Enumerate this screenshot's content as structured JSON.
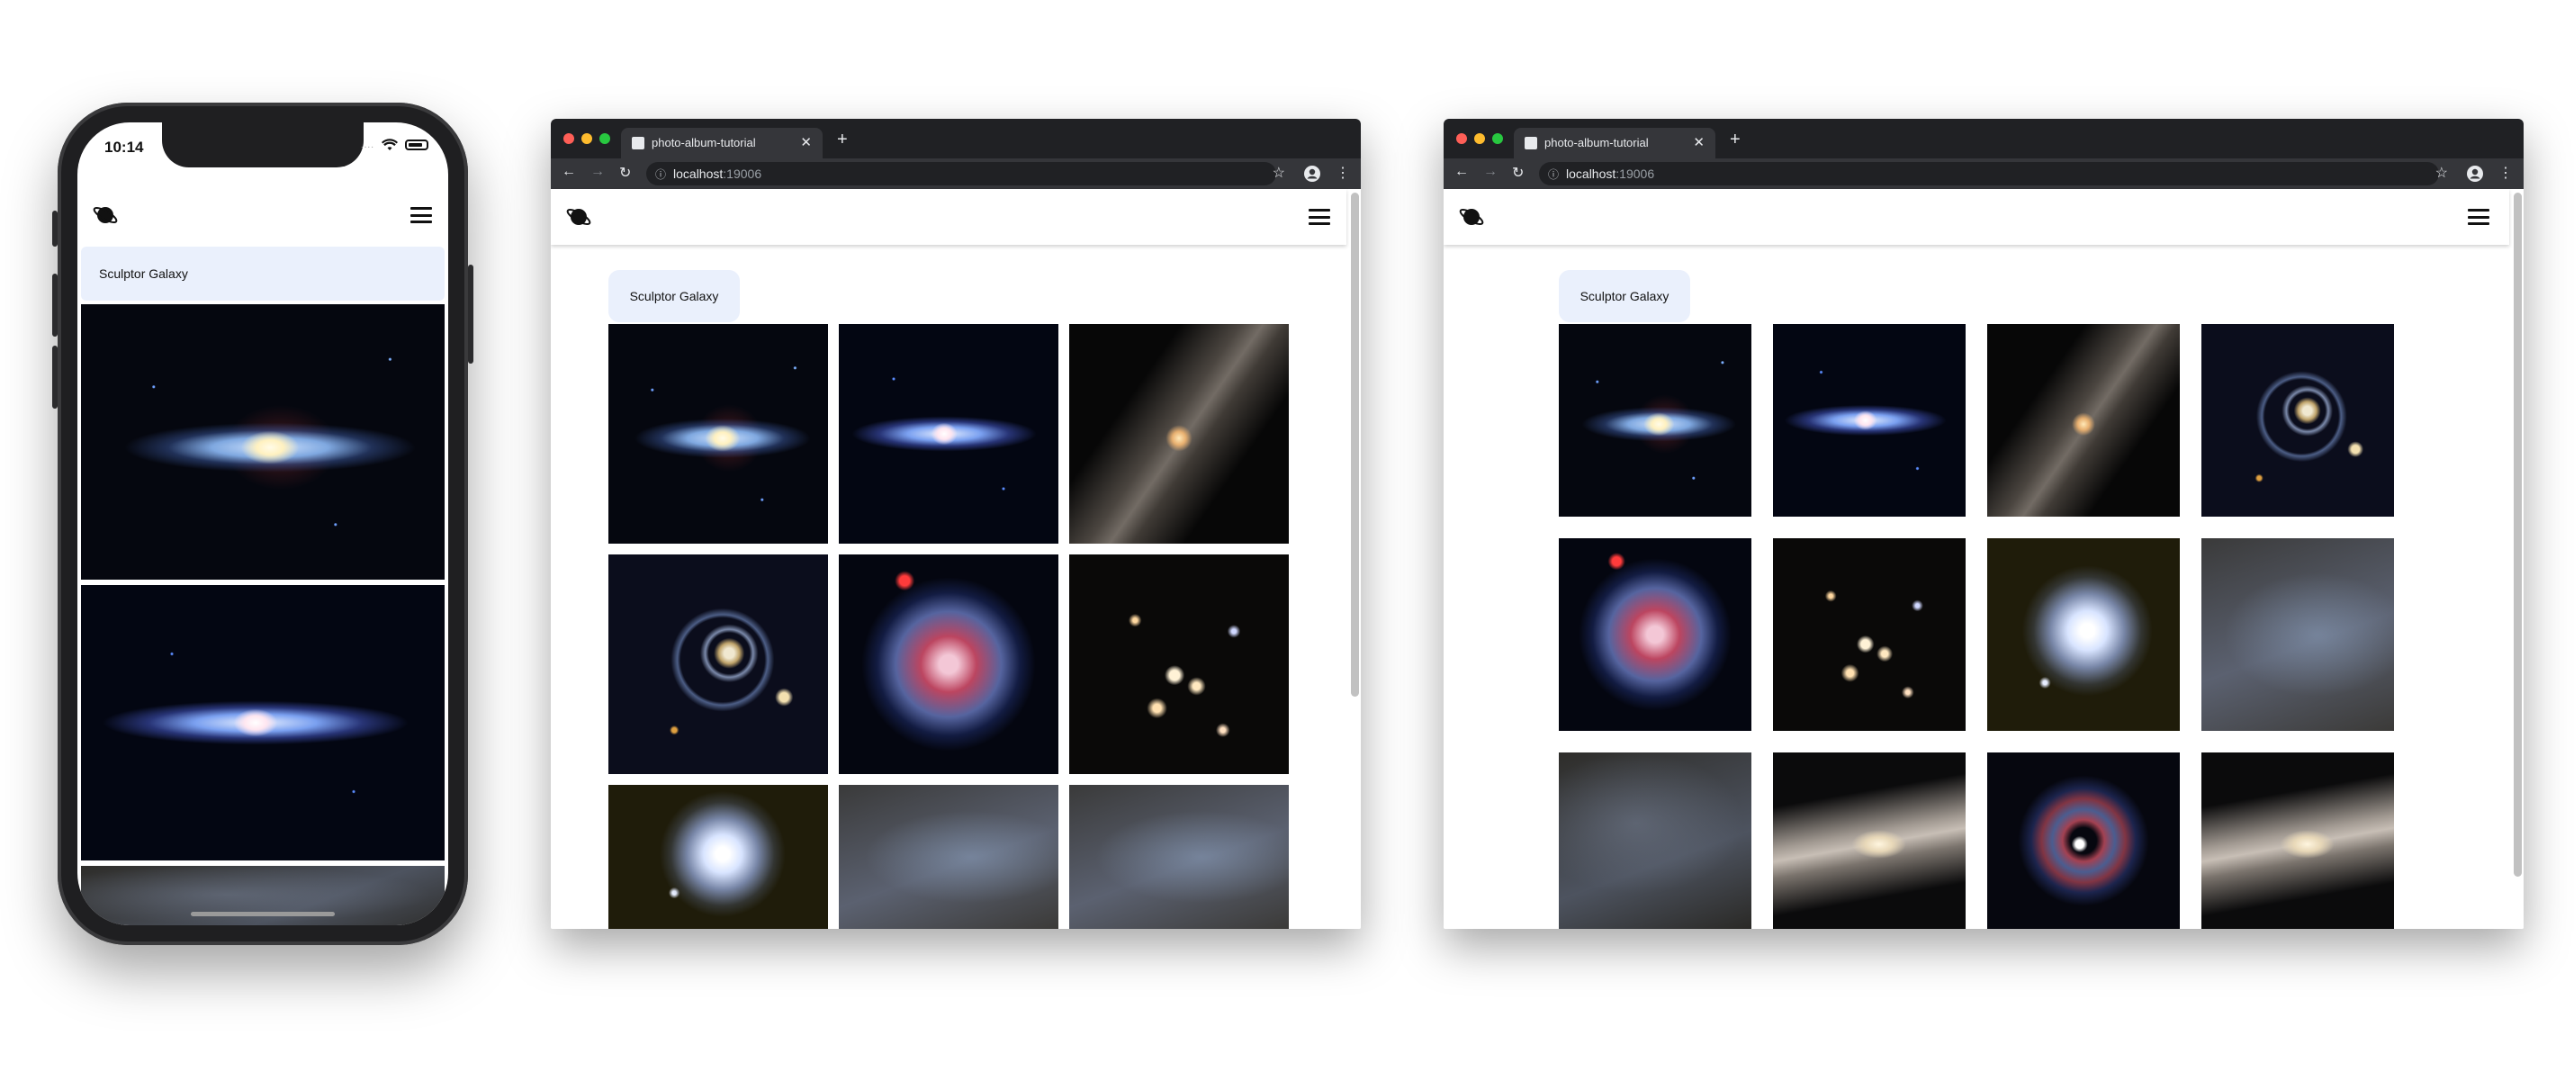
{
  "phone": {
    "status_time": "10:14",
    "status_dots": "....",
    "chip_label": "Sculptor Galaxy",
    "images": [
      "galaxy-edge-on-starburst",
      "galaxy-edge-on-blue",
      "galaxy-dusty"
    ]
  },
  "browser_small": {
    "tab_title": "photo-album-tutorial",
    "tab_close": "✕",
    "new_tab": "+",
    "address_host": "localhost",
    "address_port": ":19006",
    "chip_label": "Sculptor Galaxy",
    "images": [
      "g-edge1",
      "g-edge2",
      "g-sombre",
      "g-ring",
      "g-red",
      "g-cluster",
      "g-spiral",
      "g-dust",
      "g-dust"
    ]
  },
  "browser_large": {
    "tab_title": "photo-album-tutorial",
    "tab_close": "✕",
    "new_tab": "+",
    "address_host": "localhost",
    "address_port": ":19006",
    "chip_label": "Sculptor Galaxy",
    "images": [
      "g-edge1",
      "g-edge2",
      "g-sombre",
      "g-ring",
      "g-red",
      "g-cluster",
      "g-spiral",
      "g-dust",
      "g-dust2",
      "g-silver",
      "g-redspiral",
      "g-silver"
    ]
  },
  "icons": {
    "back": "arrow-left-icon",
    "forward": "arrow-right-icon",
    "reload": "reload-icon",
    "info": "info-icon",
    "star": "star-icon",
    "account": "account-circle-icon",
    "more": "more-vert-icon",
    "logo": "planet-logo-icon",
    "menu": "hamburger-menu-icon"
  },
  "colors": {
    "chip_bg": "#eaf0fc",
    "chrome_dark": "#202124",
    "chrome_toolbar": "#35363a",
    "traffic_red": "#ff5f57",
    "traffic_yellow": "#febc2e",
    "traffic_green": "#28c840"
  }
}
